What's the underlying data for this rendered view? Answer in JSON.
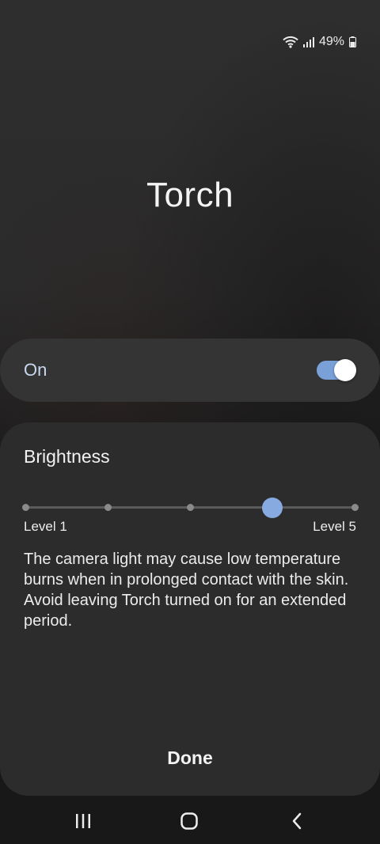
{
  "status_bar": {
    "battery_percent": "49%",
    "icons": [
      "wifi-icon",
      "signal-icon",
      "battery-icon"
    ]
  },
  "title": "Torch",
  "toggle": {
    "label": "On",
    "state": true
  },
  "brightness": {
    "label": "Brightness",
    "levels": 5,
    "current_level": 4,
    "min_label": "Level 1",
    "max_label": "Level 5"
  },
  "warning": "The camera light may cause low temperature burns when in prolonged contact with the skin. Avoid leaving Torch turned on for an extended period.",
  "done_label": "Done",
  "nav": [
    "recents-icon",
    "home-icon",
    "back-icon"
  ],
  "colors": {
    "accent": "#87abe0",
    "switch_track": "#7aa0d8",
    "panel_bg": "#2c2c2c"
  }
}
